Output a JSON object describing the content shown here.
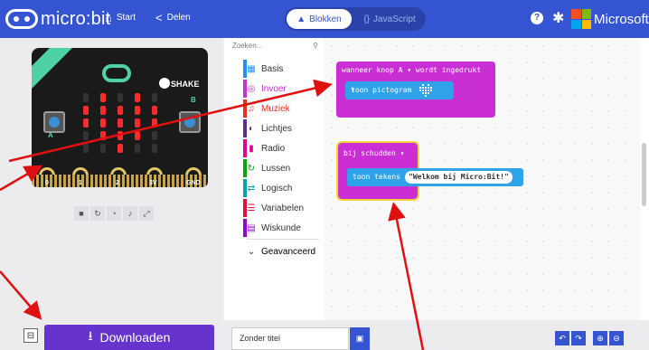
{
  "topbar": {
    "logo_text": "micro:bit",
    "start_label": "Start",
    "share_label": "Delen",
    "blocks_label": "Blokken",
    "javascript_label": "JavaScript",
    "help_label": "?",
    "brand_label": "Microsoft"
  },
  "simulator": {
    "shake_label": "SHAKE",
    "pins": [
      "0",
      "1",
      "2",
      "3V",
      "GND"
    ],
    "button_a": "A",
    "button_b": "B",
    "controls": [
      "stop",
      "restart",
      "slowmo",
      "mute",
      "fullscreen"
    ]
  },
  "toolbox": {
    "search_placeholder": "Zoeken...",
    "categories": [
      {
        "label": "Basis",
        "color": "#1e90ff",
        "icon": "grid-icon"
      },
      {
        "label": "Invoer",
        "color": "#c92fd4",
        "icon": "target-icon"
      },
      {
        "label": "Muziek",
        "color": "#e63022",
        "icon": "headphones-icon"
      },
      {
        "label": "Lichtjes",
        "color": "#5c2d91",
        "icon": "toggle-icon"
      },
      {
        "label": "Radio",
        "color": "#e3008c",
        "icon": "signal-icon"
      },
      {
        "label": "Lussen",
        "color": "#00aa00",
        "icon": "refresh-icon"
      },
      {
        "label": "Logisch",
        "color": "#00a4a6",
        "icon": "shuffle-icon"
      },
      {
        "label": "Variabelen",
        "color": "#dc143c",
        "icon": "list-icon"
      },
      {
        "label": "Wiskunde",
        "color": "#9400d3",
        "icon": "calculator-icon"
      }
    ],
    "advanced_label": "Geavanceerd"
  },
  "workspace": {
    "block1_header": "wanneer knop A ▾ wordt ingedrukt",
    "block1_inner": "toon pictogram",
    "block2_header": "bij schudden ▾",
    "block2_inner": "toon tekens",
    "block2_string": "\"Welkom bij Micro:Bit!\""
  },
  "bottombar": {
    "download_label": "Downloaden",
    "project_title": "Zonder titel",
    "project_placeholder": "Zonder titel"
  },
  "colors": {
    "topbar": "#3454d1",
    "event_block": "#c92fd4",
    "basic_block": "#2ea3e8",
    "download": "#6633cc",
    "arrow": "#e11010"
  }
}
